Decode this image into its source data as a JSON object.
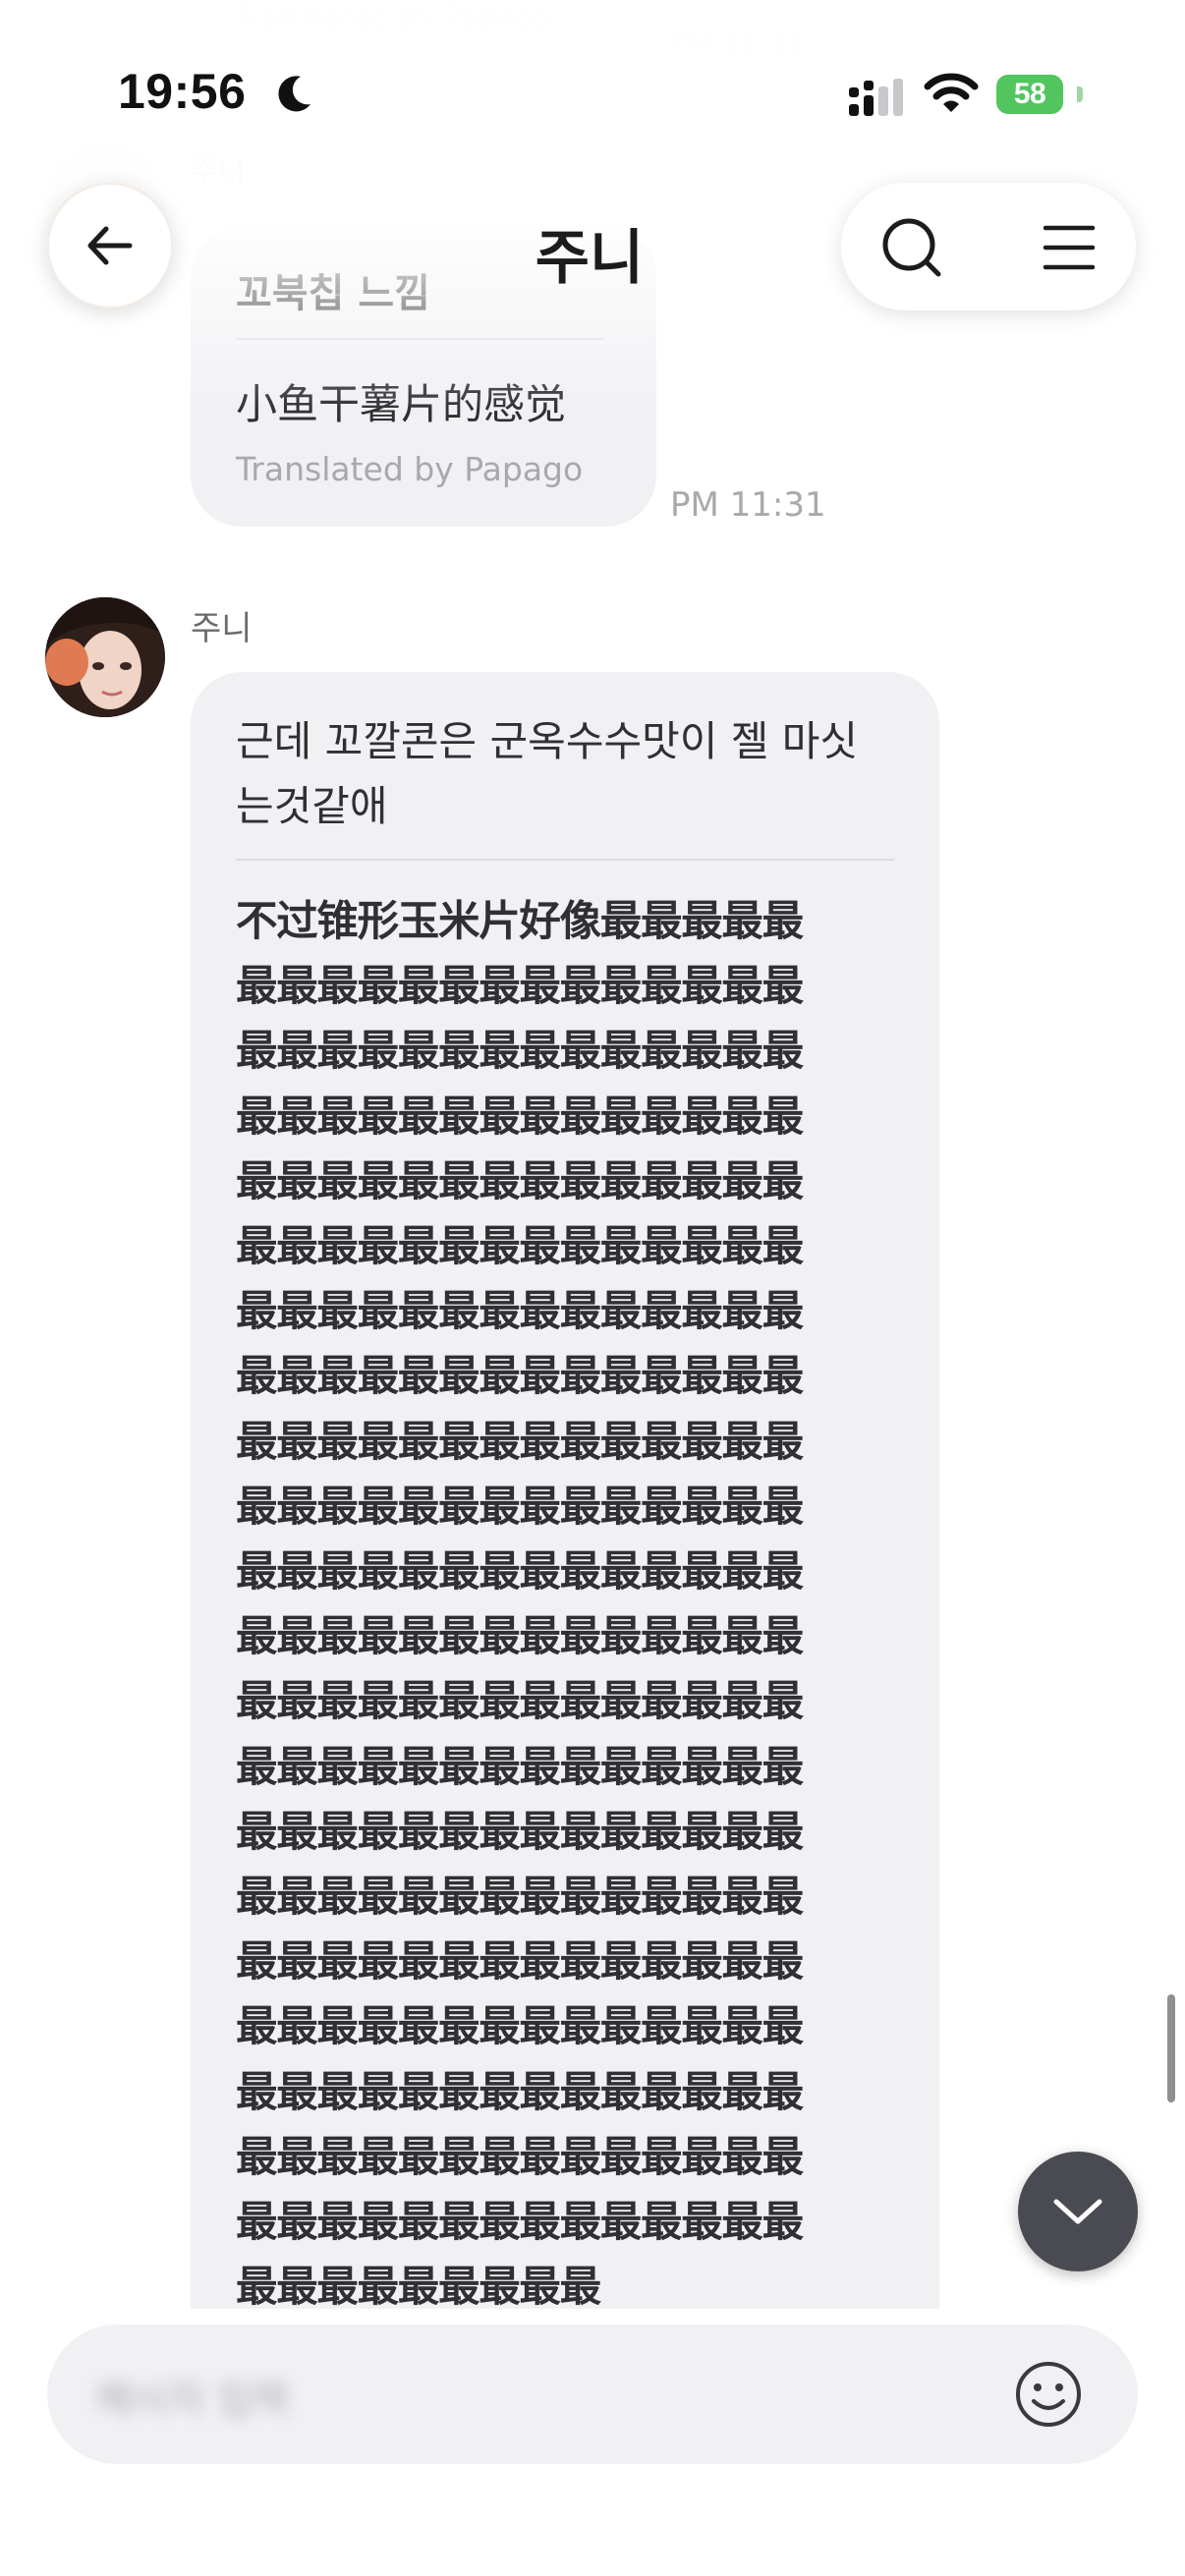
{
  "status_bar": {
    "time": "19:56",
    "battery_level": "58",
    "battery_color": "#52c55f"
  },
  "background_ghost": {
    "translated_credit": "Translated by Papago",
    "time": "PM 11:31",
    "sender": "주니"
  },
  "header": {
    "title": "주니",
    "back_icon": "arrow-left-icon",
    "search_icon": "search-icon",
    "menu_icon": "hamburger-menu-icon"
  },
  "messages": [
    {
      "original": "꼬북칩 느낌",
      "translation": "小鱼干薯片的感觉",
      "credit": "Translated by Papago",
      "time": "PM 11:31"
    },
    {
      "sender": "주니",
      "original": "근데 꼬깔콘은 군옥수수맛이 젤 마싯\n는것같애",
      "translation": "不过锥形玉米片好像最最最最最\n最最最最最最最最最最最最最最\n最最最最最最最最最最最最最最\n最最最最最最最最最最最最最最\n最最最最最最最最最最最最最最\n最最最最最最最最最最最最最最\n最最最最最最最最最最最最最最\n最最最最最最最最最最最最最最\n最最最最最最最最最最最最最最\n最最最最最最最最最最最最最最\n最最最最最最最最最最最最最最\n最最最最最最最最最最最最最最\n最最最最最最最最最最最最最最\n最最最最最最最最最最最最最最\n最最最最最最最最最最最最最最\n最最最最最最最最最最最最最最\n最最最最最最最最最最最最最最\n最最最最最最最最最最最最最最\n最最最最最最最最最最最最最最\n最最最最最最最最最最最最最最\n最最最最最最最最最最最最最最\n最最最最最最最最最"
    }
  ],
  "composer": {
    "placeholder": "메시지 입력",
    "emoji_icon": "smiley-face-icon"
  },
  "scroll_down_icon": "chevron-down-icon",
  "colors": {
    "bubble": "#f1f1f4",
    "scroll_button": "#4a4b52",
    "secondary_text": "#a8a8ad"
  }
}
